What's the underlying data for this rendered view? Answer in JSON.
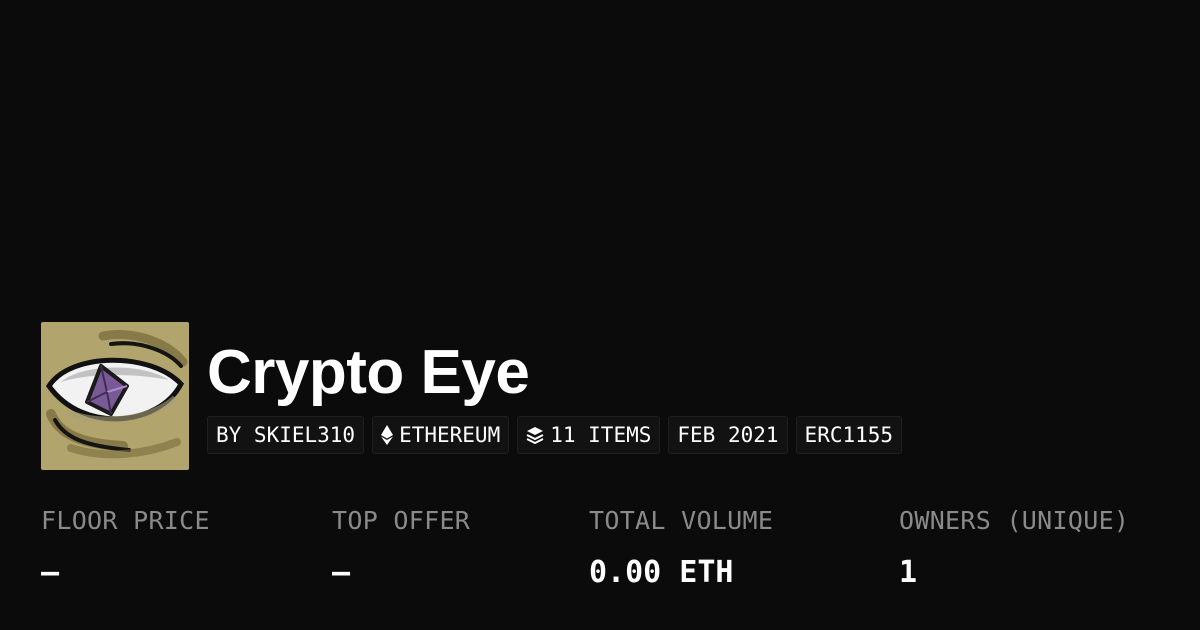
{
  "collection": {
    "name": "Crypto Eye",
    "avatar_icon": "eye-with-purple-gem-icon"
  },
  "badges": {
    "creator": "BY SKIEL310",
    "chain": "ETHEREUM",
    "chain_icon": "ethereum-icon",
    "items": "11 ITEMS",
    "items_icon": "layers-icon",
    "created": "FEB 2021",
    "standard": "ERC1155"
  },
  "stats": {
    "floor_price": {
      "label": "FLOOR PRICE",
      "value": "–"
    },
    "top_offer": {
      "label": "TOP OFFER",
      "value": "–"
    },
    "total_volume": {
      "label": "TOTAL VOLUME",
      "value": "0.00 ETH"
    },
    "owners": {
      "label": "OWNERS (UNIQUE)",
      "value": "1"
    }
  },
  "colors": {
    "background": "#0b0b0b",
    "text_primary": "#ffffff",
    "text_muted": "#8a8a8a",
    "badge_bg": "#121212",
    "avatar_bg": "#b1a46d",
    "gem": "#7a5a96"
  }
}
